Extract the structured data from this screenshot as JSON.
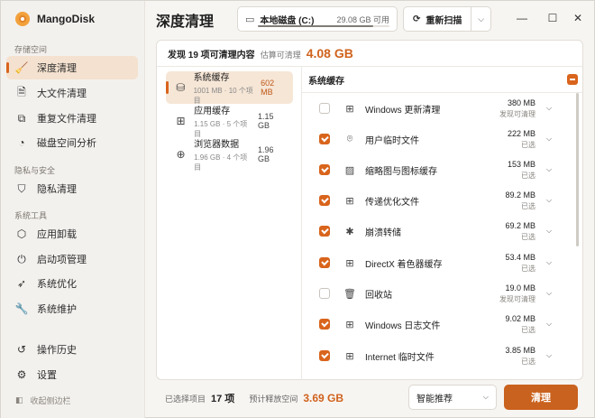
{
  "app": {
    "name": "MangoDisk",
    "accent": "#d9641c"
  },
  "sidebar": {
    "sections": [
      {
        "title": "存储空间",
        "items": [
          {
            "label": "深度清理",
            "icon": "broom-icon",
            "active": true
          },
          {
            "label": "大文件清理",
            "icon": "file-icon"
          },
          {
            "label": "重复文件清理",
            "icon": "copy-icon"
          },
          {
            "label": "磁盘空间分析",
            "icon": "pie-chart-icon"
          }
        ]
      },
      {
        "title": "隐私与安全",
        "items": [
          {
            "label": "隐私清理",
            "icon": "shield-icon"
          }
        ]
      },
      {
        "title": "系统工具",
        "items": [
          {
            "label": "应用卸载",
            "icon": "package-icon"
          },
          {
            "label": "启动项管理",
            "icon": "power-icon"
          },
          {
            "label": "系统优化",
            "icon": "rocket-icon"
          },
          {
            "label": "系统维护",
            "icon": "wrench-icon"
          }
        ]
      }
    ],
    "bottom": [
      {
        "label": "操作历史",
        "icon": "history-icon"
      },
      {
        "label": "设置",
        "icon": "gear-icon"
      }
    ],
    "collapse_label": "收起侧边栏"
  },
  "header": {
    "title": "深度清理",
    "disk": {
      "name": "本地磁盘 (C:)",
      "info": "29.08 GB 可用",
      "used_fraction": 0.88
    },
    "rescan_label": "重新扫描"
  },
  "summary": {
    "found_text": "发现 19 项可清理内容",
    "estimate_label": "估算可清理",
    "estimate_value": "4.08 GB"
  },
  "categories": [
    {
      "name": "系统缓存",
      "sub": "1001 MB · 10 个项目",
      "size": "602 MB",
      "icon": "database-icon",
      "active": true
    },
    {
      "name": "应用缓存",
      "sub": "1.15 GB · 5 个项目",
      "size": "1.15 GB",
      "icon": "apps-icon"
    },
    {
      "name": "浏览器数据",
      "sub": "1.96 GB · 4 个项目",
      "size": "1.96 GB",
      "icon": "globe-icon"
    }
  ],
  "detail": {
    "title": "系统缓存",
    "rows": [
      {
        "name": "Windows 更新清理",
        "size": "380 MB",
        "status": "发现可清理",
        "checked": false,
        "icon": "windows-icon"
      },
      {
        "name": "用户临时文件",
        "size": "222 MB",
        "status": "已选",
        "checked": true,
        "icon": "temp-file-icon"
      },
      {
        "name": "缩略图与图标缓存",
        "size": "153 MB",
        "status": "已选",
        "checked": true,
        "icon": "image-icon"
      },
      {
        "name": "传递优化文件",
        "size": "89.2 MB",
        "status": "已选",
        "checked": true,
        "icon": "windows-icon"
      },
      {
        "name": "崩溃转储",
        "size": "69.2 MB",
        "status": "已选",
        "checked": true,
        "icon": "bug-icon"
      },
      {
        "name": "DirectX 着色器缓存",
        "size": "53.4 MB",
        "status": "已选",
        "checked": true,
        "icon": "windows-icon"
      },
      {
        "name": "回收站",
        "size": "19.0 MB",
        "status": "发现可清理",
        "checked": false,
        "icon": "trash-icon"
      },
      {
        "name": "Windows 日志文件",
        "size": "9.02 MB",
        "status": "已选",
        "checked": true,
        "icon": "windows-icon"
      },
      {
        "name": "Internet 临时文件",
        "size": "3.85 MB",
        "status": "已选",
        "checked": true,
        "icon": "windows-icon"
      }
    ]
  },
  "footer": {
    "selected_label": "已选择项目",
    "selected_count": "17 项",
    "free_label": "预计释放空间",
    "free_value": "3.69 GB",
    "mode": "智能推荐",
    "clean_label": "清理"
  }
}
